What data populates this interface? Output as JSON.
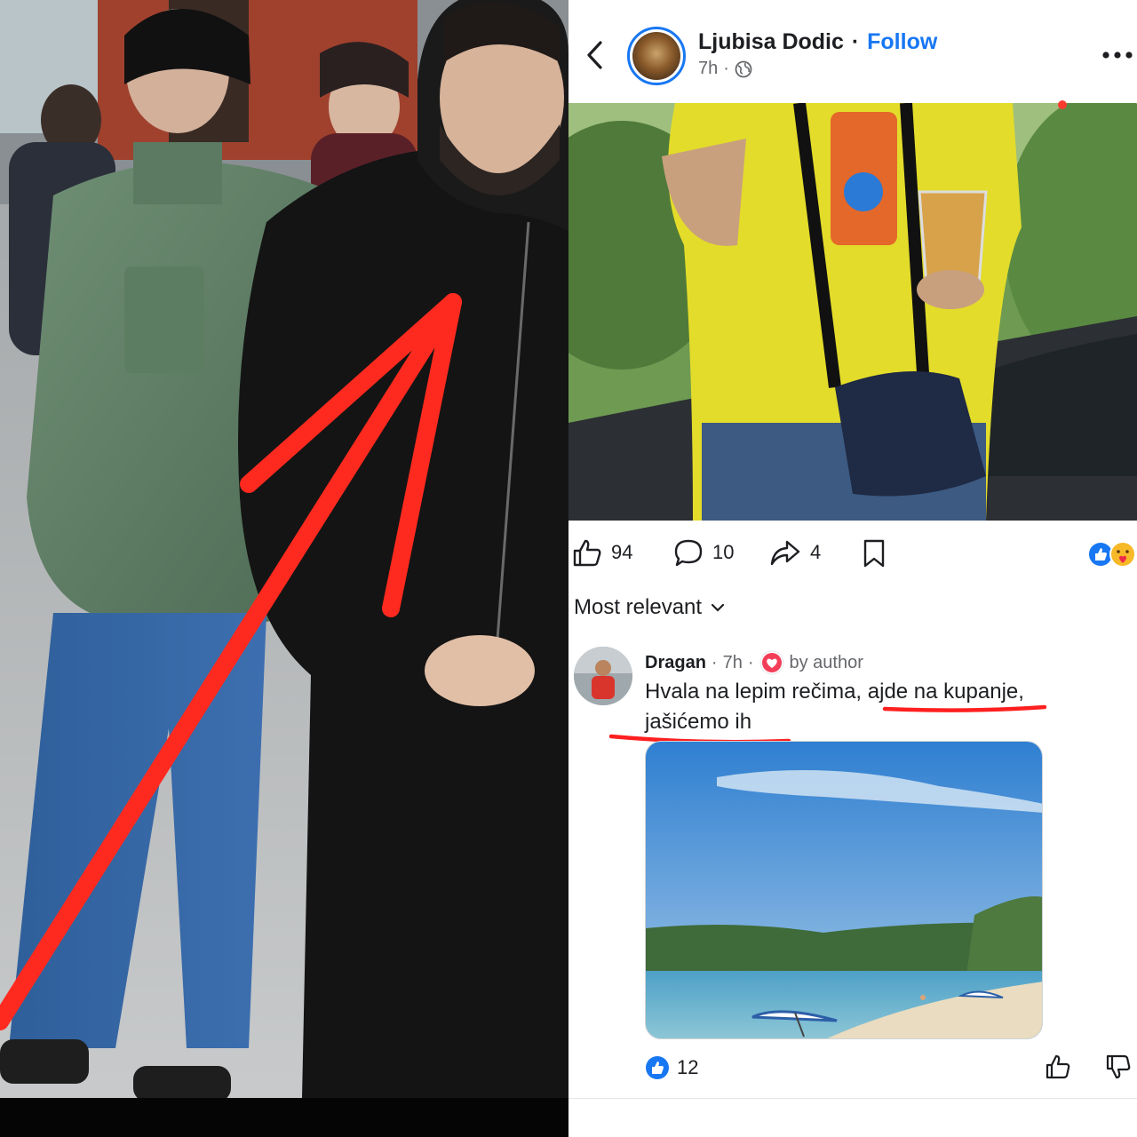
{
  "post": {
    "author_name": "Ljubisa Dodic",
    "separator": "·",
    "follow_label": "Follow",
    "time_ago": "7h",
    "meta_separator": "·",
    "privacy_icon": "globe-icon"
  },
  "actions": {
    "like_count": "94",
    "comment_count": "10",
    "share_count": "4"
  },
  "comments_sort": {
    "label": "Most relevant"
  },
  "comment": {
    "author": "Dragan",
    "time_ago": "7h",
    "by_author_label": "by author",
    "text_part1": "Hvala na lepim rečima, ",
    "text_part2": "ajde na kupanje",
    "text_part3": ", ",
    "text_part4": "jašićemo ih",
    "reaction_count": "12"
  },
  "colors": {
    "brand_blue": "#1877f2",
    "annotation_red": "#ff2a1f",
    "meta_gray": "#65676b"
  }
}
